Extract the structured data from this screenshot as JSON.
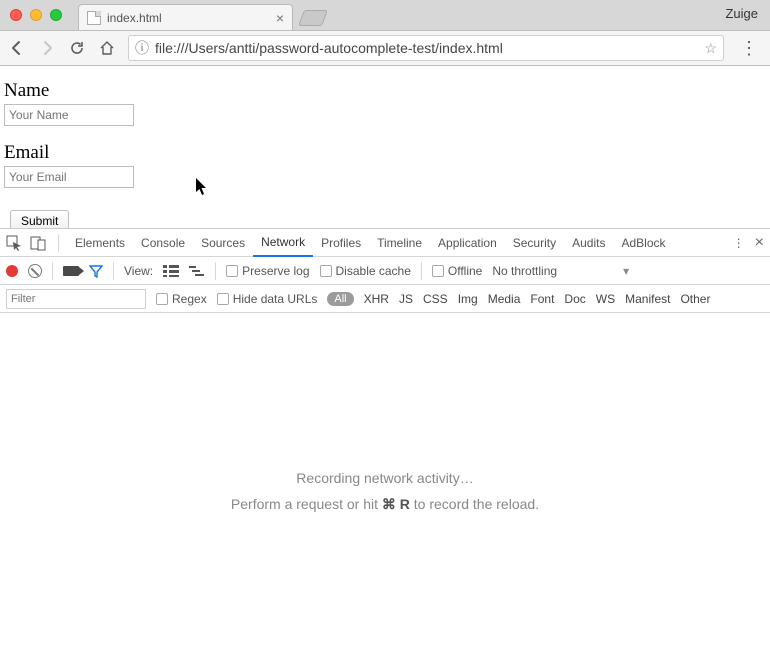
{
  "window": {
    "profile_name": "Zuige",
    "tab_title": "index.html"
  },
  "toolbar": {
    "url": "file:///Users/antti/password-autocomplete-test/index.html"
  },
  "page": {
    "name_label": "Name",
    "name_placeholder": "Your Name",
    "email_label": "Email",
    "email_placeholder": "Your Email",
    "submit_label": "Submit"
  },
  "devtools": {
    "tabs": [
      "Elements",
      "Console",
      "Sources",
      "Network",
      "Profiles",
      "Timeline",
      "Application",
      "Security",
      "Audits",
      "AdBlock"
    ],
    "active_tab": "Network",
    "bar2": {
      "view_label": "View:",
      "preserve_log": "Preserve log",
      "disable_cache": "Disable cache",
      "offline": "Offline",
      "throttling": "No throttling"
    },
    "bar3": {
      "filter_placeholder": "Filter",
      "regex": "Regex",
      "hide_data_urls": "Hide data URLs",
      "all_pill": "All",
      "types": [
        "XHR",
        "JS",
        "CSS",
        "Img",
        "Media",
        "Font",
        "Doc",
        "WS",
        "Manifest",
        "Other"
      ]
    },
    "body": {
      "line1": "Recording network activity…",
      "line2_a": "Perform a request or hit ",
      "line2_cmd": "⌘",
      "line2_r": "R",
      "line2_b": " to record the reload."
    }
  }
}
